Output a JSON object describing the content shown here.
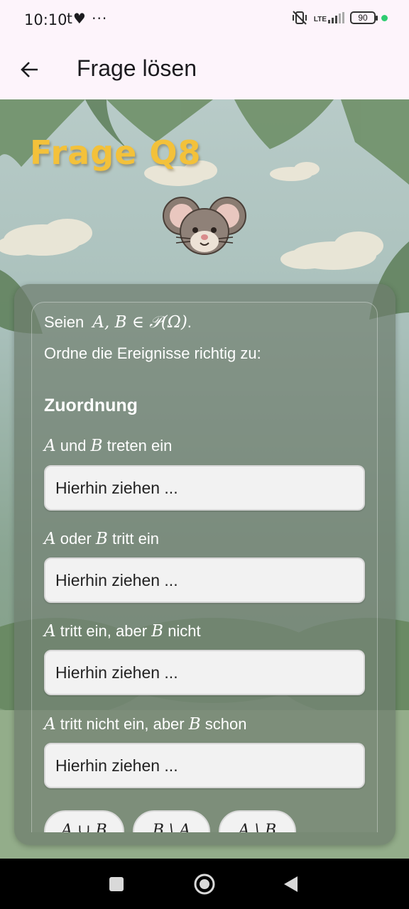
{
  "status": {
    "time": "10:10",
    "left_icons": "t♥ ···",
    "lte": "LTE",
    "battery": "90",
    "colors": {
      "dot": "#2ecc71"
    }
  },
  "app_bar": {
    "back_icon": "arrow-left-icon",
    "title": "Frage lösen"
  },
  "scene": {
    "question_title": "Frage Q8",
    "mascot": "mouse-icon"
  },
  "card": {
    "intro_prefix": "Seien",
    "intro_math": "A, B ∈ 𝒫(Ω)",
    "intro_suffix": ".",
    "instruction": "Ordne die Ereignisse richtig zu:",
    "section_heading": "Zuordnung",
    "items": [
      {
        "parts": [
          "A",
          "und",
          "B",
          "treten ein"
        ],
        "slot_placeholder": "Hierhin ziehen ..."
      },
      {
        "parts": [
          "A",
          "oder",
          "B",
          "tritt ein"
        ],
        "slot_placeholder": "Hierhin ziehen ..."
      },
      {
        "parts": [
          "A",
          "tritt ein, aber",
          "B",
          "nicht"
        ],
        "slot_placeholder": "Hierhin ziehen ..."
      },
      {
        "parts": [
          "A",
          "tritt nicht ein, aber",
          "B",
          "schon"
        ],
        "slot_placeholder": "Hierhin ziehen ..."
      }
    ],
    "chips": [
      "A ∪ B",
      "B \\ A",
      "A \\ B"
    ]
  },
  "nav": {
    "recents_icon": "square-icon",
    "home_icon": "circle-home-icon",
    "back_icon": "triangle-back-icon"
  }
}
